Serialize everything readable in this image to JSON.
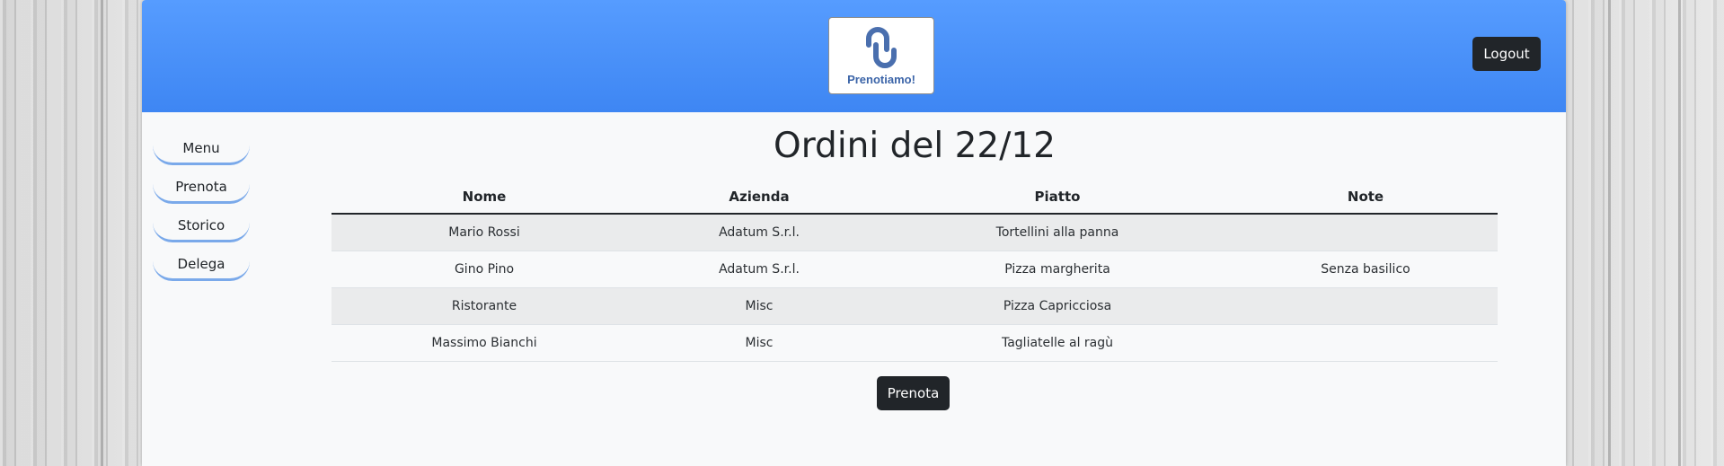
{
  "header": {
    "logo_text": "Prenotiamo!",
    "logout_label": "Logout"
  },
  "sidebar": {
    "items": [
      {
        "label": "Menu"
      },
      {
        "label": "Prenota"
      },
      {
        "label": "Storico"
      },
      {
        "label": "Delega"
      }
    ]
  },
  "main": {
    "title": "Ordini del 22/12",
    "table": {
      "columns": [
        "Nome",
        "Azienda",
        "Piatto",
        "Note"
      ],
      "rows": [
        {
          "nome": "Mario Rossi",
          "azienda": "Adatum S.r.l.",
          "piatto": "Tortellini alla panna",
          "note": ""
        },
        {
          "nome": "Gino Pino",
          "azienda": "Adatum S.r.l.",
          "piatto": "Pizza margherita",
          "note": "Senza basilico"
        },
        {
          "nome": "Ristorante",
          "azienda": "Misc",
          "piatto": "Pizza Capricciosa",
          "note": ""
        },
        {
          "nome": "Massimo Bianchi",
          "azienda": "Misc",
          "piatto": "Tagliatelle al ragù",
          "note": ""
        }
      ]
    },
    "submit_label": "Prenota"
  },
  "icons": {
    "logo": "link-chain-icon"
  },
  "colors": {
    "header_top": "#569cff",
    "header_bottom": "#3e86f3",
    "button_dark": "#212529",
    "nav_underline": "#7aa9ea",
    "logo_blue": "#4a6fae"
  }
}
